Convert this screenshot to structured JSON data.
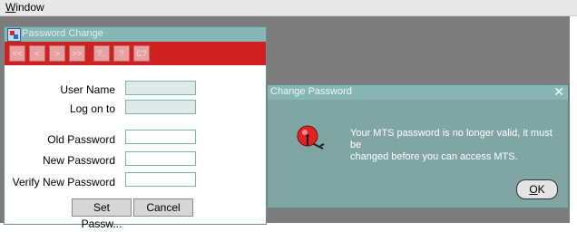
{
  "menubar": {
    "window_menu": {
      "mnemonic": "W",
      "rest": "indow"
    }
  },
  "password_change": {
    "title": "Password Change",
    "toolbar_buttons": [
      "<<",
      "<",
      ">",
      ">>",
      "?..",
      "?",
      "C?"
    ],
    "fields": [
      {
        "label": "User Name",
        "value": "",
        "disabled": true
      },
      {
        "label": "Log on to",
        "value": "",
        "disabled": true
      },
      {
        "label": "Old Password",
        "value": "",
        "disabled": false
      },
      {
        "label": "New Password",
        "value": "",
        "disabled": false
      },
      {
        "label": "Verify New Password",
        "value": "",
        "disabled": false
      }
    ],
    "set_password_label": "Set Passw...",
    "cancel_label": "Cancel"
  },
  "change_password_dialog": {
    "title": "Change Password",
    "message_line1": "Your MTS password is no longer valid, it must be",
    "message_line2": "changed before you can access MTS.",
    "ok": {
      "mnemonic": "O",
      "rest": "K"
    }
  }
}
